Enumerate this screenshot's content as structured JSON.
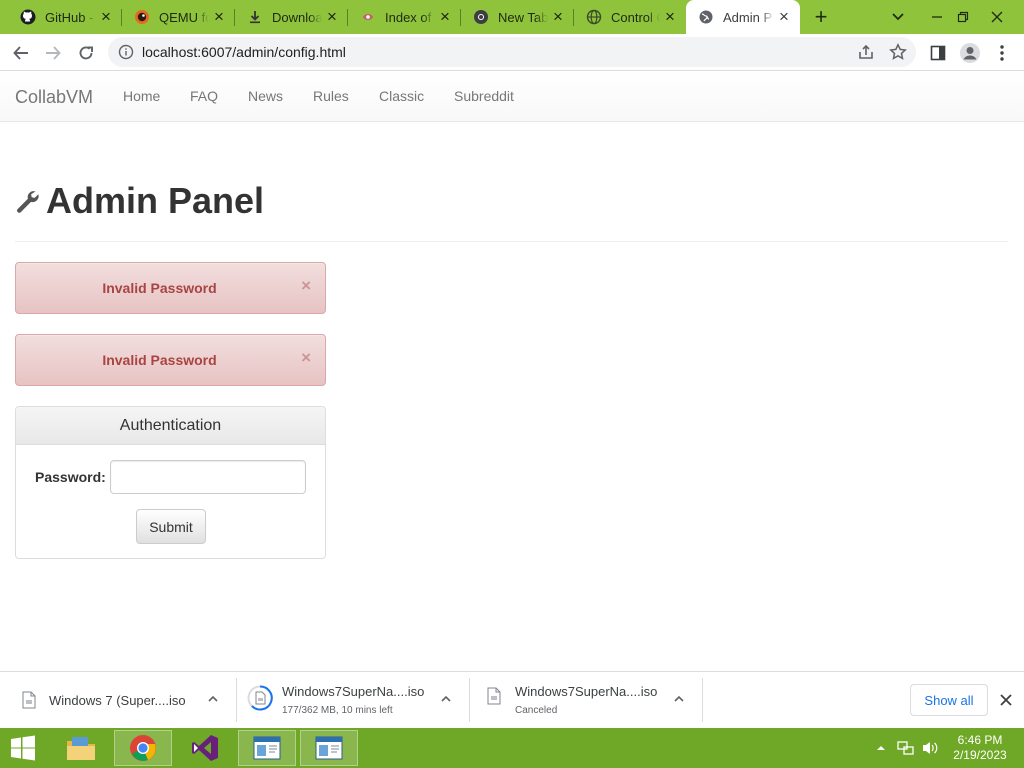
{
  "browser": {
    "tabs": [
      {
        "title": "GitHub -",
        "icon": "github-icon"
      },
      {
        "title": "QEMU fo",
        "icon": "qemu-icon"
      },
      {
        "title": "Downloa",
        "icon": "download-icon"
      },
      {
        "title": "Index of",
        "icon": "index-icon"
      },
      {
        "title": "New Tab",
        "icon": "chrome-icon"
      },
      {
        "title": "Control C",
        "icon": "globe-icon"
      },
      {
        "title": "Admin P",
        "icon": "globe-icon",
        "active": true
      }
    ],
    "url": "localhost:6007/admin/config.html"
  },
  "navbar": {
    "brand": "CollabVM",
    "links": [
      "Home",
      "FAQ",
      "News",
      "Rules",
      "Classic",
      "Subreddit"
    ]
  },
  "page": {
    "title": "Admin Panel",
    "alerts": [
      {
        "message": "Invalid Password",
        "close": "×"
      },
      {
        "message": "Invalid Password",
        "close": "×"
      }
    ],
    "auth": {
      "heading": "Authentication",
      "password_label": "Password:",
      "password_value": "",
      "submit_label": "Submit"
    }
  },
  "downloads": {
    "items": [
      {
        "name": "Windows 7 (Super....iso",
        "status": ""
      },
      {
        "name": "Windows7SuperNa....iso",
        "status": "177/362 MB, 10 mins left"
      },
      {
        "name": "Windows7SuperNa....iso",
        "status": "Canceled"
      }
    ],
    "show_all": "Show all"
  },
  "taskbar": {
    "time": "6:46 PM",
    "date": "2/19/2023"
  },
  "colors": {
    "taskbar": "#6fa827",
    "tabstrip": "#8fc33c",
    "alert_text": "#a94442",
    "link": "#1a73e8"
  }
}
